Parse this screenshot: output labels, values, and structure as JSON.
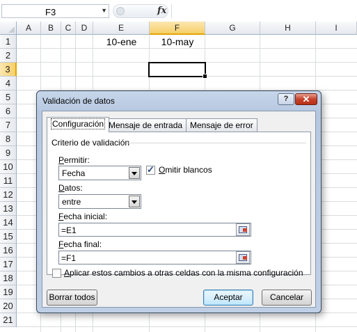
{
  "formula_bar": {
    "name_box": "F3",
    "fx_symbol": "fx",
    "formula": ""
  },
  "columns": [
    "A",
    "B",
    "C",
    "D",
    "E",
    "F",
    "G",
    "H",
    "I"
  ],
  "selected_column": "F",
  "rows": [
    "1",
    "2",
    "3",
    "4",
    "5",
    "6",
    "7",
    "8",
    "9",
    "10",
    "11",
    "12",
    "13",
    "14",
    "15",
    "16",
    "17",
    "18",
    "19",
    "20",
    "21"
  ],
  "selected_row": "3",
  "cells": {
    "E1": "10-ene",
    "F1": "10-may"
  },
  "dialog": {
    "title": "Validación de datos",
    "help_glyph": "?",
    "close_glyph": "✕",
    "tabs": [
      {
        "label": "Configuración",
        "active": true
      },
      {
        "label": "Mensaje de entrada",
        "active": false
      },
      {
        "label": "Mensaje de error",
        "active": false
      }
    ],
    "group_label": "Criterio de validación",
    "allow": {
      "label_key": "P",
      "label_rest": "ermitir:",
      "value": "Fecha"
    },
    "ignore_blank": {
      "label_key": "O",
      "label_rest": "mitir blancos",
      "checked": true
    },
    "data": {
      "label_key": "D",
      "label_rest": "atos:",
      "value": "entre"
    },
    "start_date": {
      "label_key": "F",
      "label_rest": "echa inicial:",
      "value": "=E1"
    },
    "end_date": {
      "label_key": "F",
      "label_rest": "echa final:",
      "value": "=F1"
    },
    "apply_all": {
      "label_key": "A",
      "label_rest": "plicar estos cambios a otras celdas con la misma configuración",
      "checked": false
    },
    "buttons": {
      "clear_all": "Borrar todos",
      "ok": "Aceptar",
      "cancel": "Cancelar"
    }
  }
}
